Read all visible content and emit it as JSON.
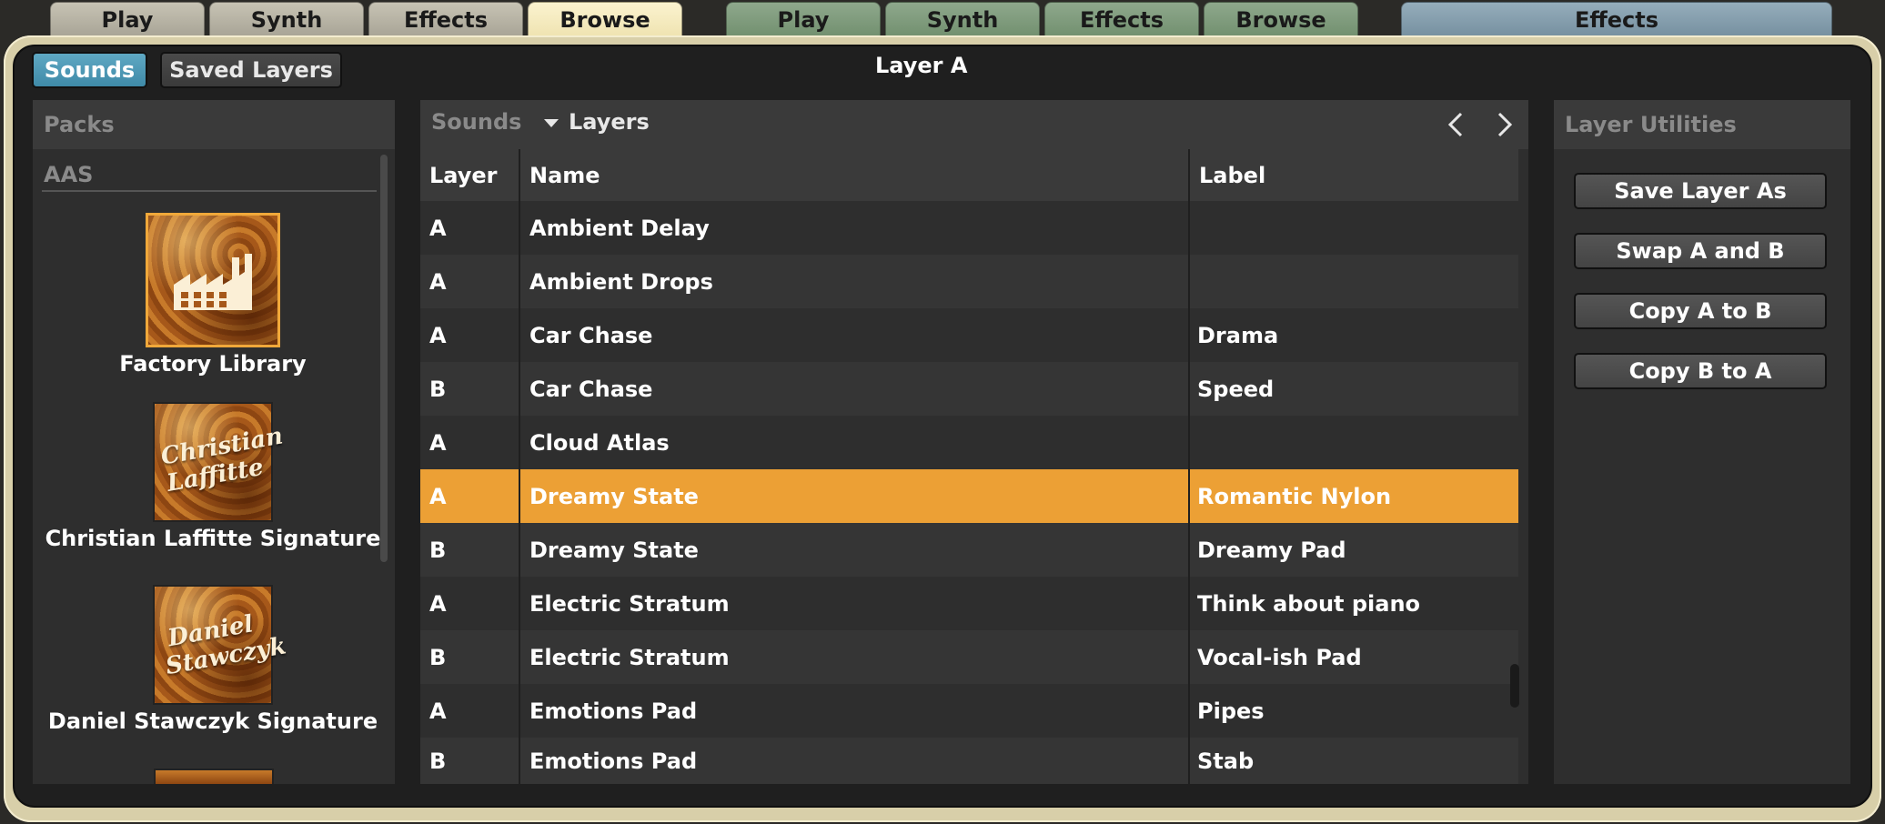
{
  "top_tabs": {
    "layer_a": [
      "Play",
      "Synth",
      "Effects",
      "Browse"
    ],
    "layer_b": [
      "Play",
      "Synth",
      "Effects",
      "Browse"
    ],
    "global": "Effects",
    "active": "Browse"
  },
  "mode_toggle": {
    "sounds": "Sounds",
    "saved_layers": "Saved Layers",
    "selected": "Sounds"
  },
  "layer_title": "Layer A",
  "packs_panel": {
    "header": "Packs",
    "group": "AAS",
    "items": [
      {
        "name": "Factory Library",
        "thumb_text": "",
        "selected": true
      },
      {
        "name": "Christian Laffitte Signature",
        "thumb_text": "Christian Laffitte"
      },
      {
        "name": "Daniel Stawczyk Signature",
        "thumb_text": "Daniel Stawczyk"
      }
    ]
  },
  "browser": {
    "breadcrumb_root": "Sounds",
    "breadcrumb_current": "Layers",
    "columns": [
      "Layer",
      "Name",
      "Label"
    ],
    "rows": [
      {
        "layer": "A",
        "name": "Ambient Delay",
        "label": ""
      },
      {
        "layer": "A",
        "name": "Ambient Drops",
        "label": ""
      },
      {
        "layer": "A",
        "name": "Car Chase",
        "label": "Drama"
      },
      {
        "layer": "B",
        "name": "Car Chase",
        "label": "Speed"
      },
      {
        "layer": "A",
        "name": "Cloud Atlas",
        "label": ""
      },
      {
        "layer": "A",
        "name": "Dreamy State",
        "label": "Romantic Nylon",
        "selected": true
      },
      {
        "layer": "B",
        "name": "Dreamy State",
        "label": "Dreamy Pad"
      },
      {
        "layer": "A",
        "name": "Electric Stratum",
        "label": "Think about piano"
      },
      {
        "layer": "B",
        "name": "Electric Stratum",
        "label": "Vocal-ish Pad"
      },
      {
        "layer": "A",
        "name": "Emotions Pad",
        "label": "Pipes"
      },
      {
        "layer": "B",
        "name": "Emotions Pad",
        "label": "Stab"
      }
    ]
  },
  "utilities": {
    "header": "Layer Utilities",
    "buttons": [
      "Save Layer As",
      "Swap A and B",
      "Copy A to B",
      "Copy B to A"
    ]
  },
  "colors": {
    "accent": "#eca035",
    "toggle_on": "#4a98b6",
    "tab_active": "#f7edc4",
    "frame": "#d8cfa9"
  }
}
